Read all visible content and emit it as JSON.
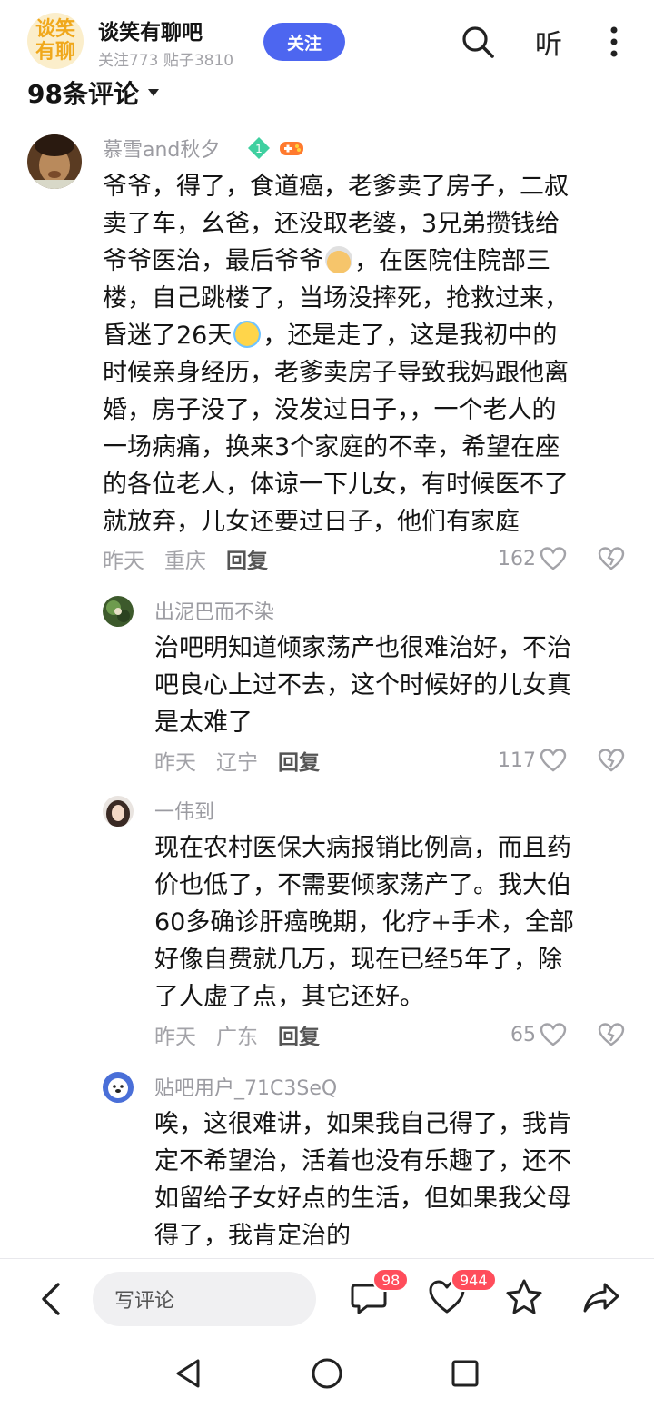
{
  "forum": {
    "logo_line1": "谈笑",
    "logo_line2": "有聊",
    "name": "谈笑有聊吧",
    "stats": "关注773 贴子3810",
    "follow_label": "关注",
    "listen_label": "听",
    "comment_count": "98条评论"
  },
  "comments": [
    {
      "username": "慕雪and秋夕",
      "level": "1",
      "lines": [
        "爷爷，得了，食道癌，老爹卖了房子，二叔",
        "卖了车，幺爸，还没取老婆，3兄弟攒钱给",
        "爷爷医治，最后爷爷",
        "，在医院住院部三",
        "楼，自己跳楼了，当场没摔死，抢救过来，",
        "昏迷了26天",
        "，还是走了，这是我初中的",
        "时候亲身经历，老爹卖房子导致我妈跟他离",
        "婚，房子没了，没发过日子，，一个老人的",
        "一场病痛，换来3个家庭的不幸，希望在座",
        "的各位老人，体谅一下儿女，有时候医不了",
        "就放弃，儿女还要过日子，他们有家庭"
      ],
      "time": "昨天",
      "location": "重庆",
      "reply_label": "回复",
      "likes": "162"
    },
    {
      "username": "出泥巴而不染",
      "lines": [
        "治吧明知道倾家荡产也很难治好，不治",
        "吧良心上过不去，这个时候好的儿女真",
        "是太难了"
      ],
      "time": "昨天",
      "location": "辽宁",
      "reply_label": "回复",
      "likes": "117"
    },
    {
      "username": "一伟到",
      "lines": [
        "现在农村医保大病报销比例高，而且药",
        "价也低了，不需要倾家荡产了。我大伯",
        "60多确诊肝癌晚期，化疗+手术，全部",
        "好像自费就几万，现在已经5年了，除",
        "了人虚了点，其它还好。"
      ],
      "time": "昨天",
      "location": "广东",
      "reply_label": "回复",
      "likes": "65"
    },
    {
      "username": "贴吧用户_71C3SeQ",
      "lines": [
        "唉，这很难讲，如果我自己得了，我肯",
        "定不希望治，活着也没有乐趣了，还不",
        "如留给子女好点的生活，但如果我父母",
        "得了，我肯定治的"
      ]
    }
  ],
  "bottom_bar": {
    "input_placeholder": "写评论",
    "comment_badge": "98",
    "like_badge": "944"
  },
  "colors": {
    "accent": "#4d66f0",
    "badge": "#ff4d5b",
    "muted": "#a3a3a8",
    "logo": "#f0a81c"
  }
}
